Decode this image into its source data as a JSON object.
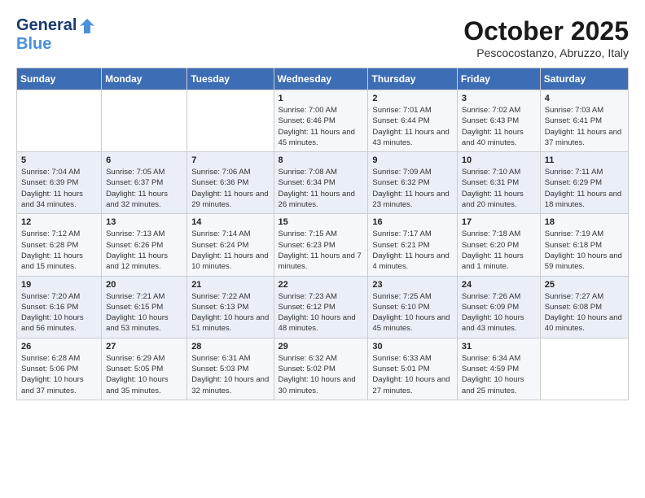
{
  "header": {
    "logo": {
      "line1": "General",
      "line2": "Blue",
      "bird_symbol": "▶"
    },
    "title": "October 2025",
    "location": "Pescocostanzo, Abruzzo, Italy"
  },
  "weekdays": [
    "Sunday",
    "Monday",
    "Tuesday",
    "Wednesday",
    "Thursday",
    "Friday",
    "Saturday"
  ],
  "weeks": [
    [
      {
        "day": "",
        "info": ""
      },
      {
        "day": "",
        "info": ""
      },
      {
        "day": "",
        "info": ""
      },
      {
        "day": "1",
        "info": "Sunrise: 7:00 AM\nSunset: 6:46 PM\nDaylight: 11 hours and 45 minutes."
      },
      {
        "day": "2",
        "info": "Sunrise: 7:01 AM\nSunset: 6:44 PM\nDaylight: 11 hours and 43 minutes."
      },
      {
        "day": "3",
        "info": "Sunrise: 7:02 AM\nSunset: 6:43 PM\nDaylight: 11 hours and 40 minutes."
      },
      {
        "day": "4",
        "info": "Sunrise: 7:03 AM\nSunset: 6:41 PM\nDaylight: 11 hours and 37 minutes."
      }
    ],
    [
      {
        "day": "5",
        "info": "Sunrise: 7:04 AM\nSunset: 6:39 PM\nDaylight: 11 hours and 34 minutes."
      },
      {
        "day": "6",
        "info": "Sunrise: 7:05 AM\nSunset: 6:37 PM\nDaylight: 11 hours and 32 minutes."
      },
      {
        "day": "7",
        "info": "Sunrise: 7:06 AM\nSunset: 6:36 PM\nDaylight: 11 hours and 29 minutes."
      },
      {
        "day": "8",
        "info": "Sunrise: 7:08 AM\nSunset: 6:34 PM\nDaylight: 11 hours and 26 minutes."
      },
      {
        "day": "9",
        "info": "Sunrise: 7:09 AM\nSunset: 6:32 PM\nDaylight: 11 hours and 23 minutes."
      },
      {
        "day": "10",
        "info": "Sunrise: 7:10 AM\nSunset: 6:31 PM\nDaylight: 11 hours and 20 minutes."
      },
      {
        "day": "11",
        "info": "Sunrise: 7:11 AM\nSunset: 6:29 PM\nDaylight: 11 hours and 18 minutes."
      }
    ],
    [
      {
        "day": "12",
        "info": "Sunrise: 7:12 AM\nSunset: 6:28 PM\nDaylight: 11 hours and 15 minutes."
      },
      {
        "day": "13",
        "info": "Sunrise: 7:13 AM\nSunset: 6:26 PM\nDaylight: 11 hours and 12 minutes."
      },
      {
        "day": "14",
        "info": "Sunrise: 7:14 AM\nSunset: 6:24 PM\nDaylight: 11 hours and 10 minutes."
      },
      {
        "day": "15",
        "info": "Sunrise: 7:15 AM\nSunset: 6:23 PM\nDaylight: 11 hours and 7 minutes."
      },
      {
        "day": "16",
        "info": "Sunrise: 7:17 AM\nSunset: 6:21 PM\nDaylight: 11 hours and 4 minutes."
      },
      {
        "day": "17",
        "info": "Sunrise: 7:18 AM\nSunset: 6:20 PM\nDaylight: 11 hours and 1 minute."
      },
      {
        "day": "18",
        "info": "Sunrise: 7:19 AM\nSunset: 6:18 PM\nDaylight: 10 hours and 59 minutes."
      }
    ],
    [
      {
        "day": "19",
        "info": "Sunrise: 7:20 AM\nSunset: 6:16 PM\nDaylight: 10 hours and 56 minutes."
      },
      {
        "day": "20",
        "info": "Sunrise: 7:21 AM\nSunset: 6:15 PM\nDaylight: 10 hours and 53 minutes."
      },
      {
        "day": "21",
        "info": "Sunrise: 7:22 AM\nSunset: 6:13 PM\nDaylight: 10 hours and 51 minutes."
      },
      {
        "day": "22",
        "info": "Sunrise: 7:23 AM\nSunset: 6:12 PM\nDaylight: 10 hours and 48 minutes."
      },
      {
        "day": "23",
        "info": "Sunrise: 7:25 AM\nSunset: 6:10 PM\nDaylight: 10 hours and 45 minutes."
      },
      {
        "day": "24",
        "info": "Sunrise: 7:26 AM\nSunset: 6:09 PM\nDaylight: 10 hours and 43 minutes."
      },
      {
        "day": "25",
        "info": "Sunrise: 7:27 AM\nSunset: 6:08 PM\nDaylight: 10 hours and 40 minutes."
      }
    ],
    [
      {
        "day": "26",
        "info": "Sunrise: 6:28 AM\nSunset: 5:06 PM\nDaylight: 10 hours and 37 minutes."
      },
      {
        "day": "27",
        "info": "Sunrise: 6:29 AM\nSunset: 5:05 PM\nDaylight: 10 hours and 35 minutes."
      },
      {
        "day": "28",
        "info": "Sunrise: 6:31 AM\nSunset: 5:03 PM\nDaylight: 10 hours and 32 minutes."
      },
      {
        "day": "29",
        "info": "Sunrise: 6:32 AM\nSunset: 5:02 PM\nDaylight: 10 hours and 30 minutes."
      },
      {
        "day": "30",
        "info": "Sunrise: 6:33 AM\nSunset: 5:01 PM\nDaylight: 10 hours and 27 minutes."
      },
      {
        "day": "31",
        "info": "Sunrise: 6:34 AM\nSunset: 4:59 PM\nDaylight: 10 hours and 25 minutes."
      },
      {
        "day": "",
        "info": ""
      }
    ]
  ]
}
